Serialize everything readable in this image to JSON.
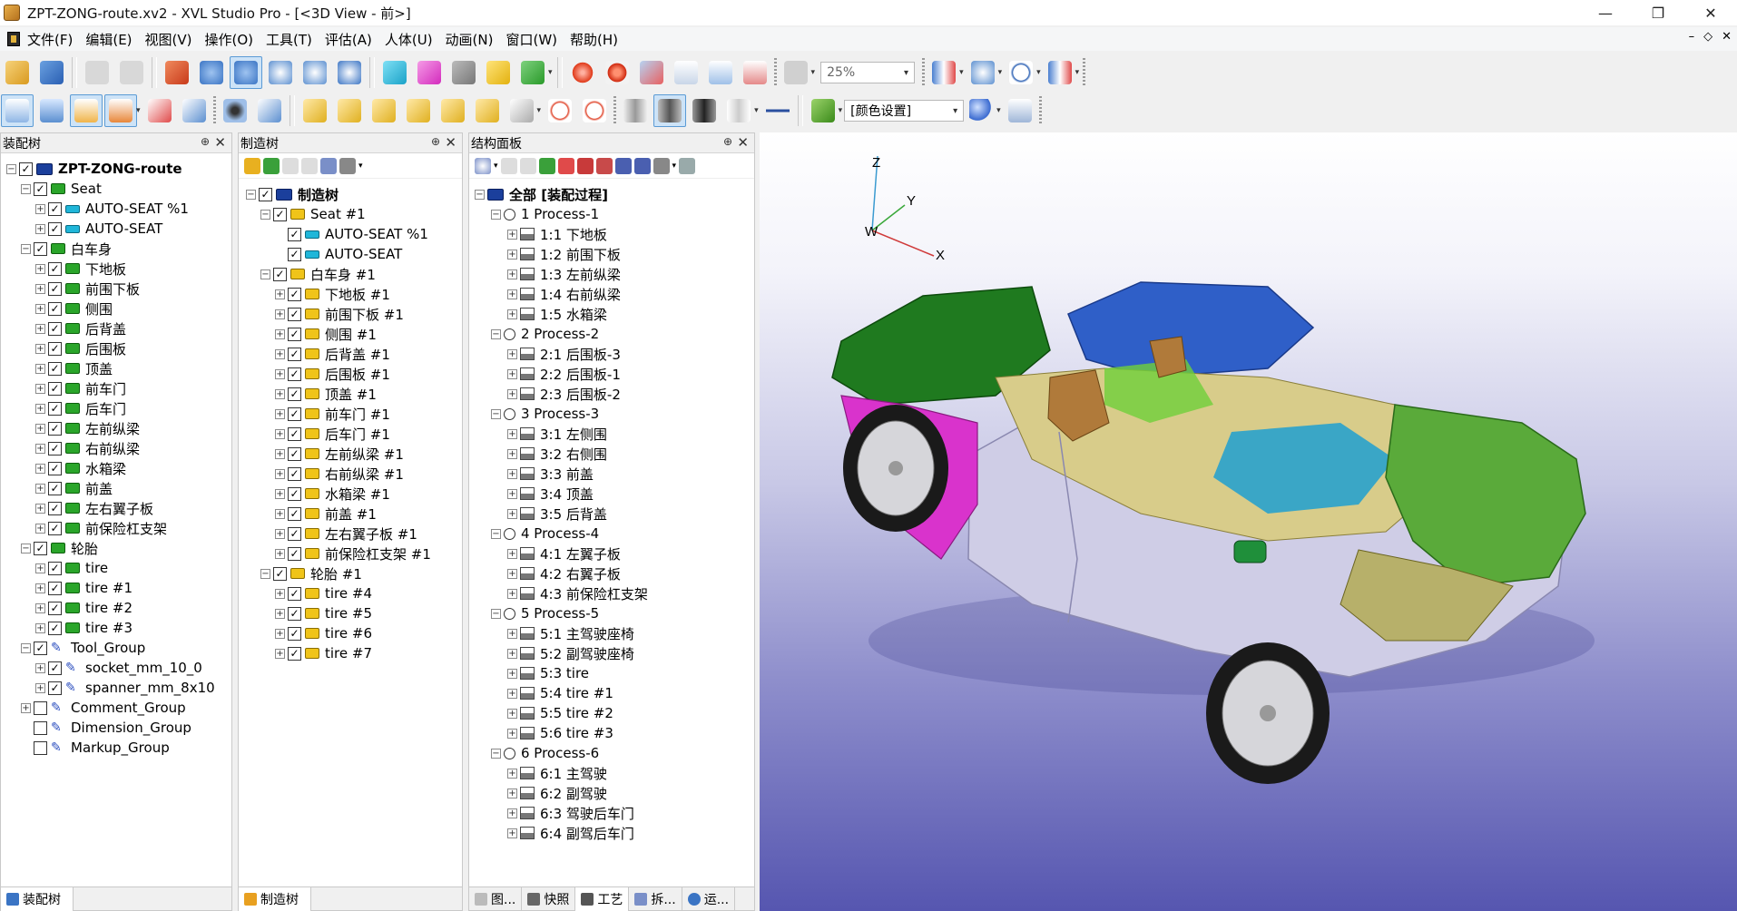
{
  "window": {
    "title": "ZPT-ZONG-route.xv2 - XVL Studio Pro - [<3D View - 前>]",
    "controls": [
      "—",
      "❐",
      "✕"
    ]
  },
  "menu": {
    "items": [
      "文件(F)",
      "编辑(E)",
      "视图(V)",
      "操作(O)",
      "工具(T)",
      "评估(A)",
      "人体(U)",
      "动画(N)",
      "窗口(W)",
      "帮助(H)"
    ],
    "mdi_controls": [
      "–",
      "◇",
      "✕"
    ]
  },
  "toolbar": {
    "zoom_value": "25%",
    "color_setting": "[颜色设置]"
  },
  "assembly_panel": {
    "title": "装配树",
    "pin": "⊕",
    "close": "✕",
    "rows": [
      {
        "label": "ZPT-ZONG-route",
        "level": 0,
        "exp": "−",
        "cb": "✓",
        "icon": "blue-root",
        "bold": true
      },
      {
        "label": "Seat",
        "level": 1,
        "exp": "−",
        "cb": "✓",
        "icon": "green"
      },
      {
        "label": "AUTO-SEAT %1",
        "level": 2,
        "exp": "+",
        "cb": "✓",
        "icon": "cyan"
      },
      {
        "label": "AUTO-SEAT",
        "level": 2,
        "exp": "+",
        "cb": "✓",
        "icon": "cyan"
      },
      {
        "label": "白车身",
        "level": 1,
        "exp": "−",
        "cb": "✓",
        "icon": "green"
      },
      {
        "label": "下地板",
        "level": 2,
        "exp": "+",
        "cb": "✓",
        "icon": "green"
      },
      {
        "label": "前围下板",
        "level": 2,
        "exp": "+",
        "cb": "✓",
        "icon": "green"
      },
      {
        "label": "侧围",
        "level": 2,
        "exp": "+",
        "cb": "✓",
        "icon": "green"
      },
      {
        "label": "后背盖",
        "level": 2,
        "exp": "+",
        "cb": "✓",
        "icon": "green"
      },
      {
        "label": "后围板",
        "level": 2,
        "exp": "+",
        "cb": "✓",
        "icon": "green"
      },
      {
        "label": "顶盖",
        "level": 2,
        "exp": "+",
        "cb": "✓",
        "icon": "green"
      },
      {
        "label": "前车门",
        "level": 2,
        "exp": "+",
        "cb": "✓",
        "icon": "green"
      },
      {
        "label": "后车门",
        "level": 2,
        "exp": "+",
        "cb": "✓",
        "icon": "green"
      },
      {
        "label": "左前纵梁",
        "level": 2,
        "exp": "+",
        "cb": "✓",
        "icon": "green"
      },
      {
        "label": "右前纵梁",
        "level": 2,
        "exp": "+",
        "cb": "✓",
        "icon": "green"
      },
      {
        "label": "水箱梁",
        "level": 2,
        "exp": "+",
        "cb": "✓",
        "icon": "green"
      },
      {
        "label": "前盖",
        "level": 2,
        "exp": "+",
        "cb": "✓",
        "icon": "green"
      },
      {
        "label": "左右翼子板",
        "level": 2,
        "exp": "+",
        "cb": "✓",
        "icon": "green"
      },
      {
        "label": "前保险杠支架",
        "level": 2,
        "exp": "+",
        "cb": "✓",
        "icon": "green"
      },
      {
        "label": "轮胎",
        "level": 1,
        "exp": "−",
        "cb": "✓",
        "icon": "green"
      },
      {
        "label": "tire",
        "level": 2,
        "exp": "+",
        "cb": "✓",
        "icon": "green"
      },
      {
        "label": "tire #1",
        "level": 2,
        "exp": "+",
        "cb": "✓",
        "icon": "green"
      },
      {
        "label": "tire #2",
        "level": 2,
        "exp": "+",
        "cb": "✓",
        "icon": "green"
      },
      {
        "label": "tire #3",
        "level": 2,
        "exp": "+",
        "cb": "✓",
        "icon": "green"
      },
      {
        "label": "Tool_Group",
        "level": 1,
        "exp": "−",
        "cb": "✓",
        "icon": "tool"
      },
      {
        "label": "socket_mm_10_0",
        "level": 2,
        "exp": "+",
        "cb": "✓",
        "icon": "tool"
      },
      {
        "label": "spanner_mm_8x10",
        "level": 2,
        "exp": "+",
        "cb": "✓",
        "icon": "tool"
      },
      {
        "label": "Comment_Group",
        "level": 1,
        "exp": "+",
        "cb": "",
        "icon": "tool"
      },
      {
        "label": "Dimension_Group",
        "level": 1,
        "exp": "",
        "cb": "",
        "icon": "tool"
      },
      {
        "label": "Markup_Group",
        "level": 1,
        "exp": "",
        "cb": "",
        "icon": "tool"
      }
    ],
    "footer_tab": "装配树"
  },
  "mfg_panel": {
    "title": "制造树",
    "pin": "⊕",
    "close": "✕",
    "rows": [
      {
        "label": "制造树",
        "level": 0,
        "exp": "−",
        "cb": "✓",
        "icon": "blue-root",
        "bold": true
      },
      {
        "label": "Seat #1",
        "level": 1,
        "exp": "−",
        "cb": "✓",
        "icon": "yellow"
      },
      {
        "label": "AUTO-SEAT %1",
        "level": 2,
        "exp": "",
        "cb": "✓",
        "icon": "cyan"
      },
      {
        "label": "AUTO-SEAT",
        "level": 2,
        "exp": "",
        "cb": "✓",
        "icon": "cyan"
      },
      {
        "label": "白车身 #1",
        "level": 1,
        "exp": "−",
        "cb": "✓",
        "icon": "yellow"
      },
      {
        "label": "下地板 #1",
        "level": 2,
        "exp": "+",
        "cb": "✓",
        "icon": "yellow"
      },
      {
        "label": "前围下板 #1",
        "level": 2,
        "exp": "+",
        "cb": "✓",
        "icon": "yellow"
      },
      {
        "label": "侧围 #1",
        "level": 2,
        "exp": "+",
        "cb": "✓",
        "icon": "yellow"
      },
      {
        "label": "后背盖 #1",
        "level": 2,
        "exp": "+",
        "cb": "✓",
        "icon": "yellow"
      },
      {
        "label": "后围板 #1",
        "level": 2,
        "exp": "+",
        "cb": "✓",
        "icon": "yellow"
      },
      {
        "label": "顶盖 #1",
        "level": 2,
        "exp": "+",
        "cb": "✓",
        "icon": "yellow"
      },
      {
        "label": "前车门 #1",
        "level": 2,
        "exp": "+",
        "cb": "✓",
        "icon": "yellow"
      },
      {
        "label": "后车门 #1",
        "level": 2,
        "exp": "+",
        "cb": "✓",
        "icon": "yellow"
      },
      {
        "label": "左前纵梁 #1",
        "level": 2,
        "exp": "+",
        "cb": "✓",
        "icon": "yellow"
      },
      {
        "label": "右前纵梁 #1",
        "level": 2,
        "exp": "+",
        "cb": "✓",
        "icon": "yellow"
      },
      {
        "label": "水箱梁 #1",
        "level": 2,
        "exp": "+",
        "cb": "✓",
        "icon": "yellow"
      },
      {
        "label": "前盖 #1",
        "level": 2,
        "exp": "+",
        "cb": "✓",
        "icon": "yellow"
      },
      {
        "label": "左右翼子板 #1",
        "level": 2,
        "exp": "+",
        "cb": "✓",
        "icon": "yellow"
      },
      {
        "label": "前保险杠支架 #1",
        "level": 2,
        "exp": "+",
        "cb": "✓",
        "icon": "yellow"
      },
      {
        "label": "轮胎 #1",
        "level": 1,
        "exp": "−",
        "cb": "✓",
        "icon": "yellow"
      },
      {
        "label": "tire #4",
        "level": 2,
        "exp": "+",
        "cb": "✓",
        "icon": "yellow"
      },
      {
        "label": "tire #5",
        "level": 2,
        "exp": "+",
        "cb": "✓",
        "icon": "yellow"
      },
      {
        "label": "tire #6",
        "level": 2,
        "exp": "+",
        "cb": "✓",
        "icon": "yellow"
      },
      {
        "label": "tire #7",
        "level": 2,
        "exp": "+",
        "cb": "✓",
        "icon": "yellow"
      }
    ],
    "footer_tab": "制造树"
  },
  "struct_panel": {
    "title": "结构面板",
    "pin": "⊕",
    "close": "✕",
    "rows": [
      {
        "label": "全部 [装配过程]",
        "level": 0,
        "exp": "−",
        "icon": "blue-root",
        "bold": true
      },
      {
        "label": "1 Process-1",
        "level": 1,
        "exp": "−",
        "icon": "circle"
      },
      {
        "label": "1:1 下地板",
        "level": 2,
        "exp": "+",
        "icon": "proc"
      },
      {
        "label": "1:2 前围下板",
        "level": 2,
        "exp": "+",
        "icon": "proc"
      },
      {
        "label": "1:3 左前纵梁",
        "level": 2,
        "exp": "+",
        "icon": "proc"
      },
      {
        "label": "1:4 右前纵梁",
        "level": 2,
        "exp": "+",
        "icon": "proc"
      },
      {
        "label": "1:5 水箱梁",
        "level": 2,
        "exp": "+",
        "icon": "proc"
      },
      {
        "label": "2 Process-2",
        "level": 1,
        "exp": "−",
        "icon": "circle"
      },
      {
        "label": "2:1 后围板-3",
        "level": 2,
        "exp": "+",
        "icon": "proc"
      },
      {
        "label": "2:2 后围板-1",
        "level": 2,
        "exp": "+",
        "icon": "proc"
      },
      {
        "label": "2:3 后围板-2",
        "level": 2,
        "exp": "+",
        "icon": "proc"
      },
      {
        "label": "3 Process-3",
        "level": 1,
        "exp": "−",
        "icon": "circle"
      },
      {
        "label": "3:1 左侧围",
        "level": 2,
        "exp": "+",
        "icon": "proc"
      },
      {
        "label": "3:2 右侧围",
        "level": 2,
        "exp": "+",
        "icon": "proc"
      },
      {
        "label": "3:3 前盖",
        "level": 2,
        "exp": "+",
        "icon": "proc"
      },
      {
        "label": "3:4 顶盖",
        "level": 2,
        "exp": "+",
        "icon": "proc"
      },
      {
        "label": "3:5 后背盖",
        "level": 2,
        "exp": "+",
        "icon": "proc"
      },
      {
        "label": "4 Process-4",
        "level": 1,
        "exp": "−",
        "icon": "circle"
      },
      {
        "label": "4:1 左翼子板",
        "level": 2,
        "exp": "+",
        "icon": "proc"
      },
      {
        "label": "4:2 右翼子板",
        "level": 2,
        "exp": "+",
        "icon": "proc"
      },
      {
        "label": "4:3 前保险杠支架",
        "level": 2,
        "exp": "+",
        "icon": "proc"
      },
      {
        "label": "5 Process-5",
        "level": 1,
        "exp": "−",
        "icon": "circle"
      },
      {
        "label": "5:1 主驾驶座椅",
        "level": 2,
        "exp": "+",
        "icon": "proc"
      },
      {
        "label": "5:2 副驾驶座椅",
        "level": 2,
        "exp": "+",
        "icon": "proc"
      },
      {
        "label": "5:3 tire",
        "level": 2,
        "exp": "+",
        "icon": "proc"
      },
      {
        "label": "5:4 tire #1",
        "level": 2,
        "exp": "+",
        "icon": "proc"
      },
      {
        "label": "5:5 tire #2",
        "level": 2,
        "exp": "+",
        "icon": "proc"
      },
      {
        "label": "5:6 tire #3",
        "level": 2,
        "exp": "+",
        "icon": "proc"
      },
      {
        "label": "6 Process-6",
        "level": 1,
        "exp": "−",
        "icon": "circle"
      },
      {
        "label": "6:1 主驾驶",
        "level": 2,
        "exp": "+",
        "icon": "proc"
      },
      {
        "label": "6:2 副驾驶",
        "level": 2,
        "exp": "+",
        "icon": "proc"
      },
      {
        "label": "6:3 驾驶后车门",
        "level": 2,
        "exp": "+",
        "icon": "proc"
      },
      {
        "label": "6:4 副驾后车门",
        "level": 2,
        "exp": "+",
        "icon": "proc"
      }
    ],
    "footer_tabs": [
      "图...",
      "快照",
      "工艺",
      "拆...",
      "运..."
    ]
  },
  "view3d": {
    "axis_labels": {
      "z": "Z",
      "y": "Y",
      "w": "W",
      "x": "X"
    }
  }
}
